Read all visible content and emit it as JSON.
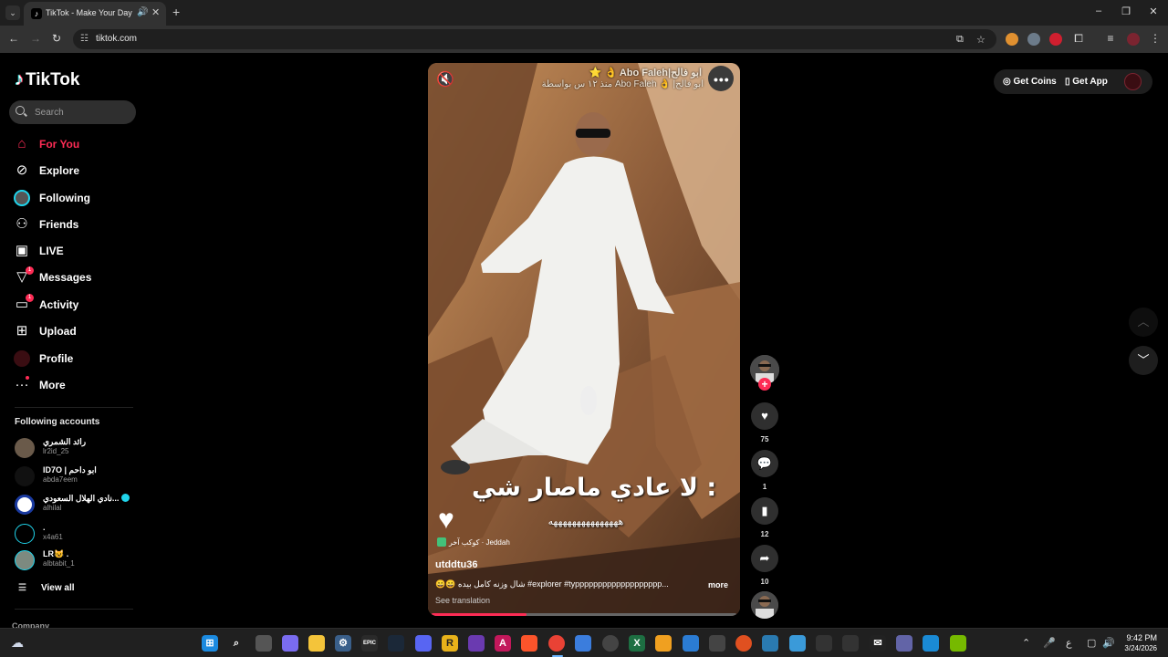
{
  "browser": {
    "tab_title": "TikTok - Make Your Day",
    "url": "tiktok.com",
    "new_tab": "+"
  },
  "sidebar": {
    "logo_text": "TikTok",
    "search_placeholder": "Search",
    "nav": [
      {
        "label": "For You",
        "icon": "home-icon",
        "active": true
      },
      {
        "label": "Explore",
        "icon": "compass-icon"
      },
      {
        "label": "Following",
        "icon": "following-avatar-icon"
      },
      {
        "label": "Friends",
        "icon": "friends-icon"
      },
      {
        "label": "LIVE",
        "icon": "live-icon"
      },
      {
        "label": "Messages",
        "icon": "messages-icon",
        "badge": "1"
      },
      {
        "label": "Activity",
        "icon": "activity-icon",
        "badge": "1"
      },
      {
        "label": "Upload",
        "icon": "upload-icon"
      },
      {
        "label": "Profile",
        "icon": "profile-icon"
      },
      {
        "label": "More",
        "icon": "more-icon"
      }
    ],
    "following_title": "Following accounts",
    "accounts": [
      {
        "name": "رائد الشمري",
        "handle": "lr2id_25"
      },
      {
        "name": "ID7O | ابو داحم",
        "handle": "abda7eem"
      },
      {
        "name": "نادي الهلال السعودي...",
        "handle": "alhilal",
        "verified": true
      },
      {
        "name": ".",
        "handle": "x4a61"
      },
      {
        "name": "LR😺 .",
        "handle": "albtabit_1"
      }
    ],
    "view_all": "View all",
    "company": "Company"
  },
  "video": {
    "caption_top_line1": "⭐ 👌 Abo Faleh|ابو فالح",
    "caption_top_line2": "منذ ١٢ س بواسطة Abo Faleh 👌 |ابو فالح",
    "overlay_big": "لا عادي ماصار شي :",
    "overlay_small": "هههههههههههههههه",
    "location": "كوكب آخر · Jeddah",
    "author": "utddtu36",
    "description": "😄😄 شال وزنه كامل بيده #explorer #typpppppppppppppppppp...",
    "more": "more",
    "see_translation": "See translation",
    "progress": 0.31
  },
  "actions": {
    "likes": "75",
    "comments": "1",
    "saves": "12",
    "shares": "10"
  },
  "topright": {
    "get_coins": "Get Coins",
    "get_app": "Get App"
  },
  "taskbar": {
    "time": "9:42 PM",
    "date": "3/24/2026",
    "lang": "ع"
  },
  "colors": {
    "accent": "#fe2c55",
    "background": "#000000",
    "verified": "#20d5ec"
  }
}
